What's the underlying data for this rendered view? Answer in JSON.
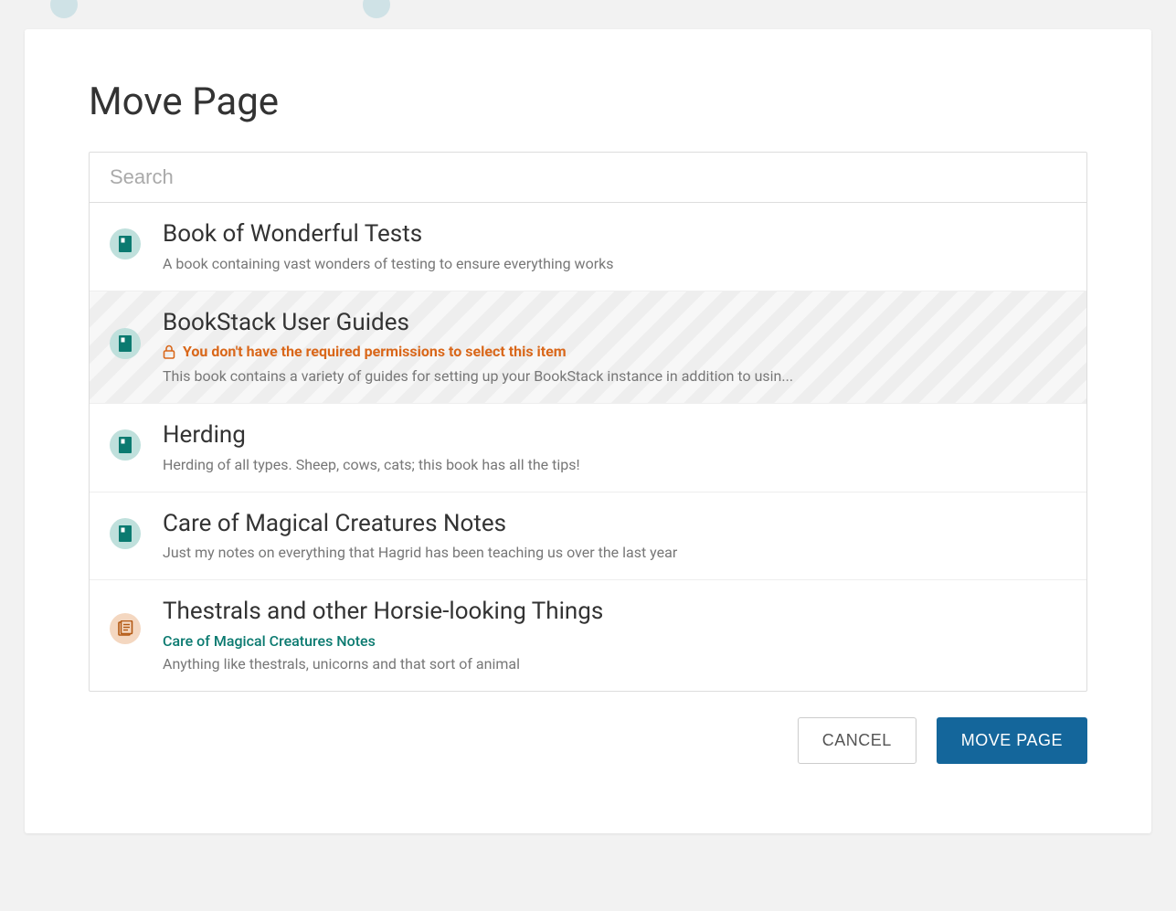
{
  "page": {
    "title": "Move Page"
  },
  "search": {
    "placeholder": "Search"
  },
  "permission_warning": "You don't have the required permissions to select this item",
  "items": [
    {
      "type": "book",
      "title": "Book of Wonderful Tests",
      "desc": "A book containing vast wonders of testing to ensure everything works",
      "disabled": false
    },
    {
      "type": "book",
      "title": "BookStack User Guides",
      "desc": "This book contains a variety of guides for setting up your BookStack instance in addition to usin...",
      "disabled": true
    },
    {
      "type": "book",
      "title": "Herding",
      "desc": "Herding of all types. Sheep, cows, cats; this book has all the tips!",
      "disabled": false
    },
    {
      "type": "book",
      "title": "Care of Magical Creatures Notes",
      "desc": "Just my notes on everything that Hagrid has been teaching us over the last year",
      "disabled": false
    },
    {
      "type": "chapter",
      "title": "Thestrals and other Horsie-looking Things",
      "parent": "Care of Magical Creatures Notes",
      "desc": "Anything like thestrals, unicorns and that sort of animal",
      "disabled": false
    }
  ],
  "actions": {
    "cancel": "CANCEL",
    "move": "MOVE PAGE"
  }
}
